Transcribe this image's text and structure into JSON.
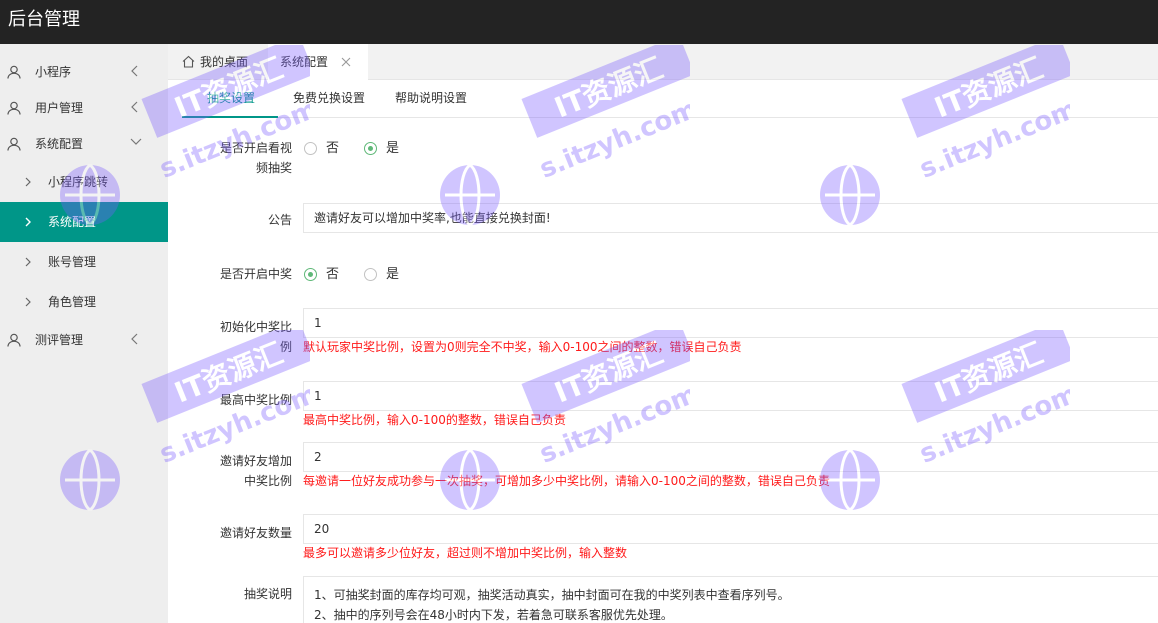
{
  "app": {
    "title": "后台管理"
  },
  "sidebar": {
    "items": [
      {
        "label": "小程序"
      },
      {
        "label": "用户管理"
      },
      {
        "label": "系统配置"
      },
      {
        "label": "测评管理"
      }
    ],
    "subitems": [
      {
        "label": "小程序跳转"
      },
      {
        "label": "系统配置"
      },
      {
        "label": "账号管理"
      },
      {
        "label": "角色管理"
      }
    ],
    "active": "系统配置"
  },
  "tabs": {
    "home": "我的桌面",
    "current": "系统配置"
  },
  "subtabs": [
    "抽奖设置",
    "免费兑换设置",
    "帮助说明设置"
  ],
  "form": {
    "video_lottery": {
      "label_line1": "是否开启看视",
      "label_line2": "频抽奖",
      "options": [
        "否",
        "是"
      ],
      "selected": "是"
    },
    "notice": {
      "label": "公告",
      "value": "邀请好友可以增加中奖率,也能直接兑换封面!"
    },
    "win_enabled": {
      "label": "是否开启中奖",
      "options": [
        "否",
        "是"
      ],
      "selected": "否"
    },
    "init_rate": {
      "label_line1": "初始化中奖比",
      "label_line2": "例",
      "value": "1",
      "hint": "默认玩家中奖比例，设置为0则完全不中奖，输入0-100之间的整数，错误自己负责"
    },
    "max_rate": {
      "label": "最高中奖比例",
      "value": "1",
      "hint": "最高中奖比例，输入0-100的整数，错误自己负责"
    },
    "invite_rate": {
      "label_line1": "邀请好友增加",
      "label_line2": "中奖比例",
      "value": "2",
      "hint": "每邀请一位好友成功参与一次抽奖，可增加多少中奖比例，请输入0-100之间的整数，错误自己负责"
    },
    "invite_count": {
      "label": "邀请好友数量",
      "value": "20",
      "hint": "最多可以邀请多少位好友，超过则不增加中奖比例，输入整数"
    },
    "lottery_desc": {
      "label": "抽奖说明",
      "line1": "1、可抽奖封面的库存均可观，抽奖活动真实，抽中封面可在我的中奖列表中查看序列号。",
      "line2": "2、抽中的序列号会在48小时内下发，若着急可联系客服优先处理。"
    }
  },
  "watermark": {
    "text": "IT资源汇",
    "url": "s.itzyh.com"
  },
  "colors": {
    "topbar": "#232323",
    "accent": "#009688",
    "radio": "#5fb878",
    "hint": "#ff1a1a",
    "watermark": "#7a5cff"
  }
}
